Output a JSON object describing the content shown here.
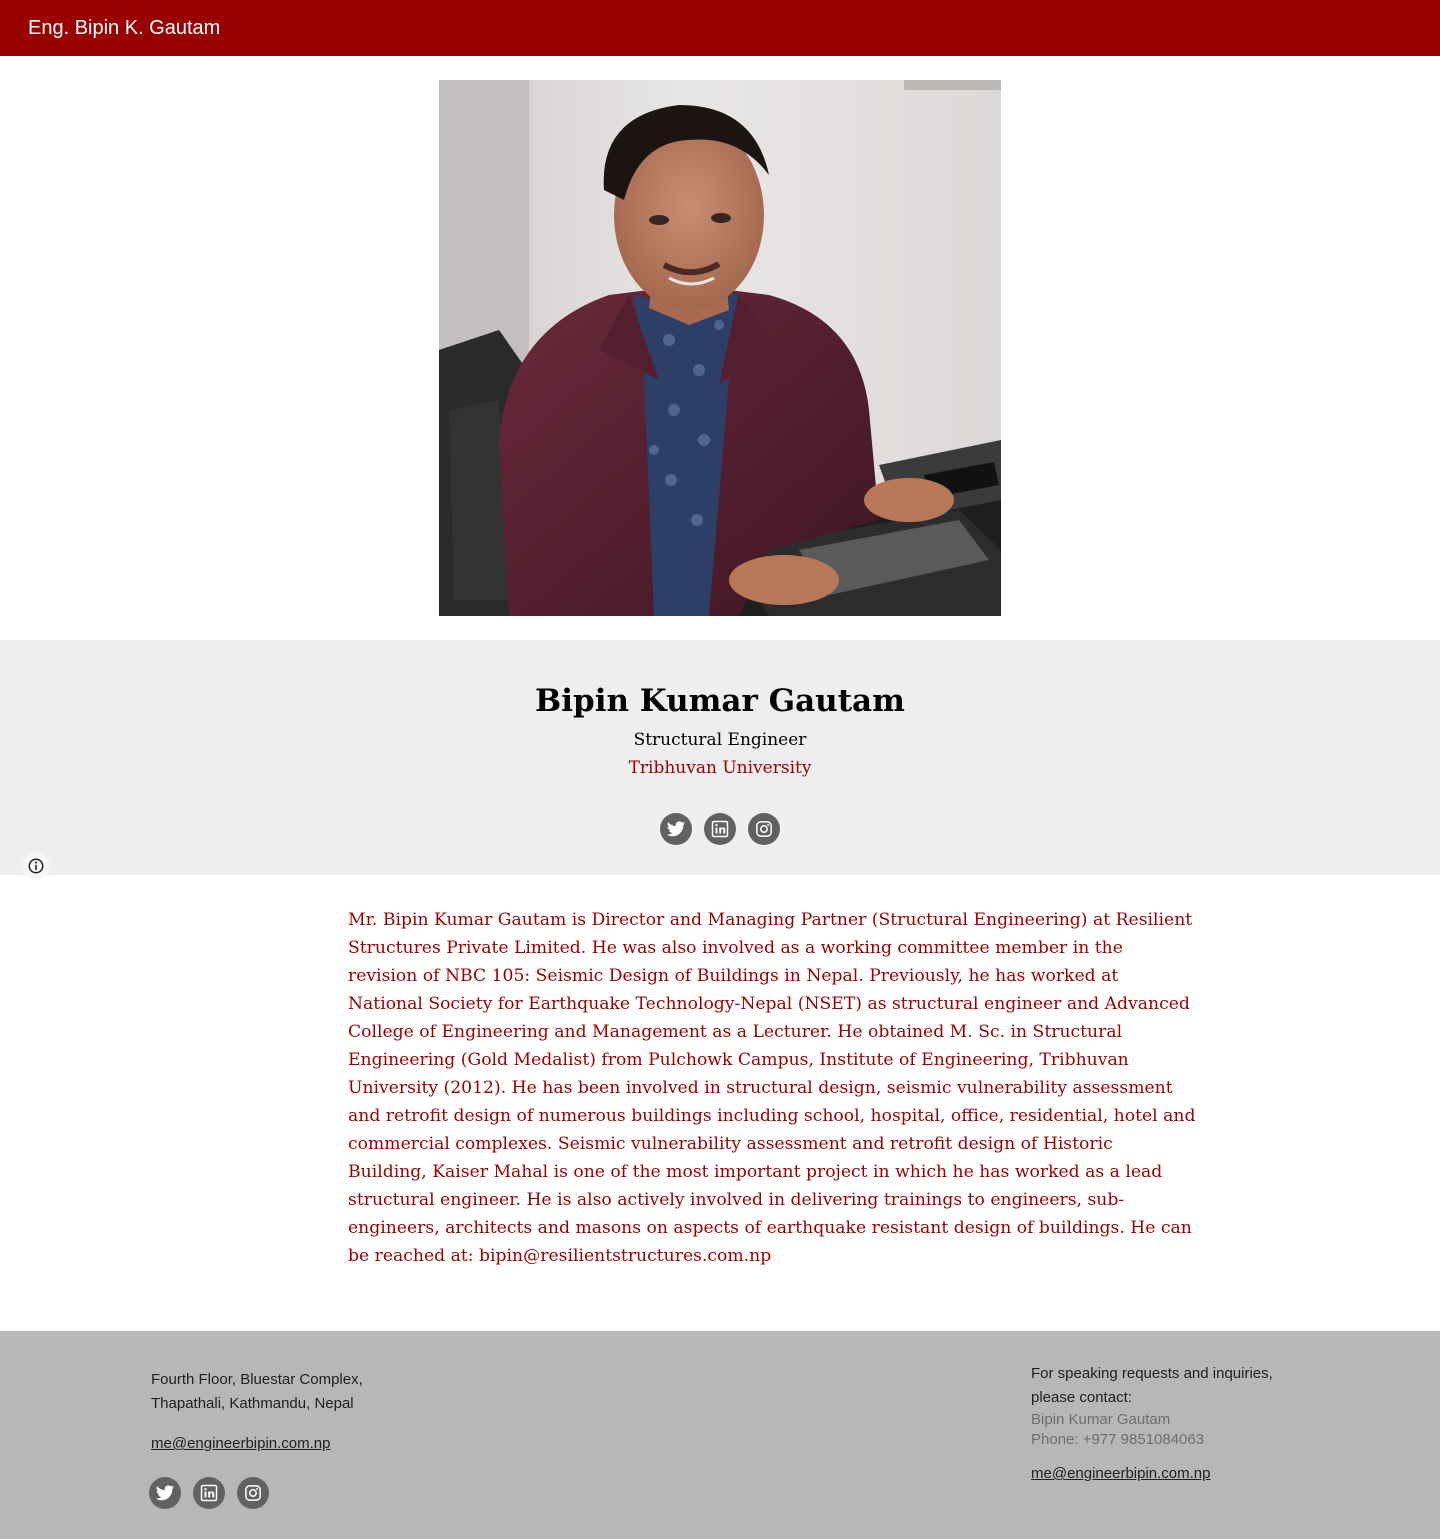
{
  "header": {
    "site_title": "Eng. Bipin K. Gautam",
    "brand_color": "#990000"
  },
  "profile": {
    "photo_alt": "Portrait of Bipin Kumar Gautam seated at a desk with a laptop",
    "name": "Bipin Kumar Gautam",
    "role": "Structural Engineer",
    "affiliation": "Tribhuvan University",
    "social": [
      {
        "label": "Twitter",
        "icon": "twitter-icon"
      },
      {
        "label": "LinkedIn",
        "icon": "linkedin-icon"
      },
      {
        "label": "Instagram",
        "icon": "instagram-icon"
      }
    ]
  },
  "bio": {
    "text": "Mr. Bipin Kumar Gautam is Director and Managing Partner (Structural Engineering) at Resilient Structures Private Limited. He was also involved as a working committee member in the revision of NBC 105: Seismic Design of Buildings in Nepal. Previously, he has worked at National Society for Earthquake Technology-Nepal (NSET) as structural engineer and Advanced College of Engineering and Management as a Lecturer. He obtained M. Sc. in Structural Engineering (Gold Medalist) from Pulchowk Campus, Institute of Engineering, Tribhuvan University (2012). He has been involved in structural design, seismic vulnerability assessment and retrofit design of numerous buildings including school, hospital, office, residential, hotel and commercial complexes. Seismic vulnerability assessment and retrofit design of Historic Building, Kaiser Mahal is one of the most important project in which he has worked as a lead structural engineer. He is also actively involved in delivering trainings to engineers, sub-engineers, architects and masons on aspects of earthquake resistant design of buildings. He can be reached at: bipin@resilientstructures.com.np"
  },
  "footer": {
    "address_line1": "Fourth Floor, Bluestar Complex,",
    "address_line2": "Thapathali, Kathmandu, Nepal",
    "email": "me@engineerbipin.com.np",
    "contact_intro": "For speaking requests and inquiries, please contact:",
    "contact_name": "Bipin Kumar Gautam",
    "contact_phone": "Phone: +977 9851084063",
    "contact_email": "me@engineerbipin.com.np"
  },
  "icons": {
    "info": "info-icon"
  },
  "colors": {
    "accent": "#990000",
    "hero_background": "#eeeeee",
    "footer_background": "#b7b7b7",
    "social_icon_background": "#616161"
  }
}
